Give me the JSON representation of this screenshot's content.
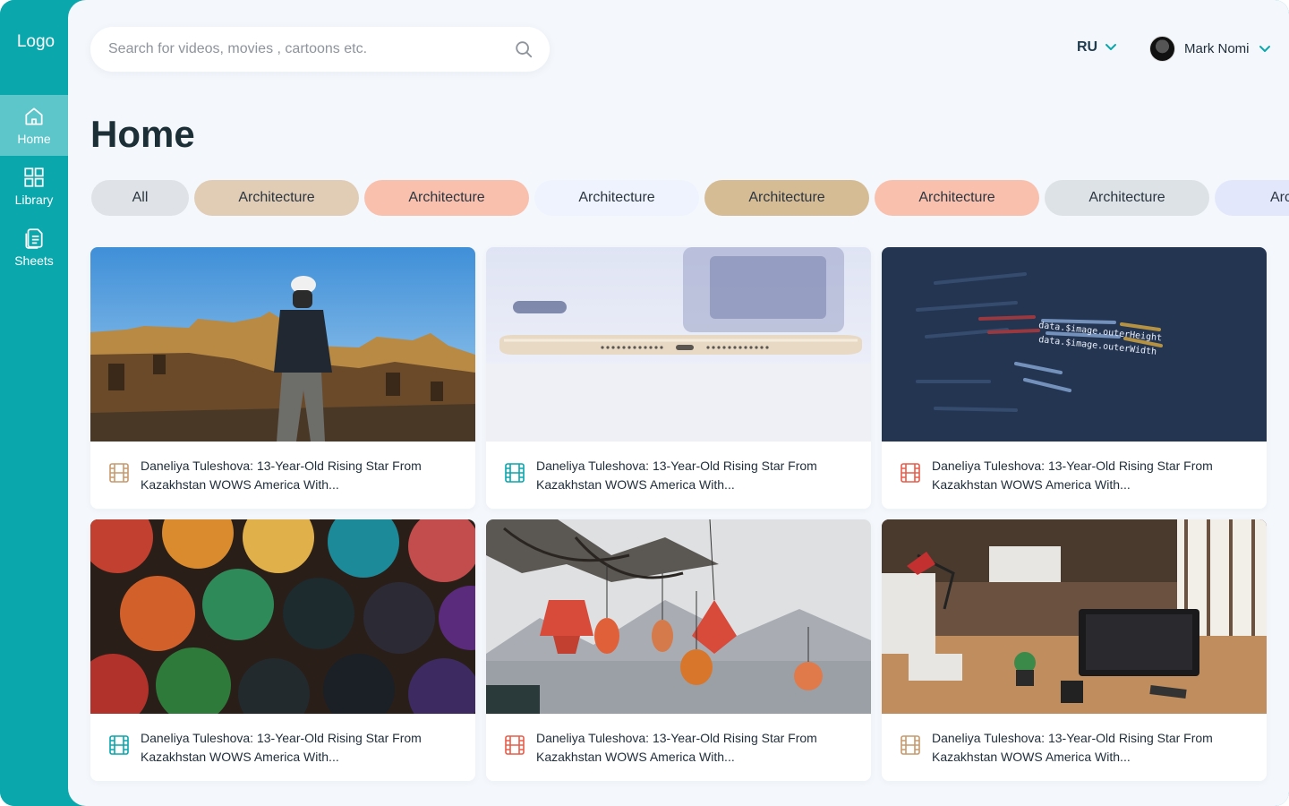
{
  "app": {
    "logo": "Logo"
  },
  "sidebar": {
    "items": [
      {
        "label": "Home",
        "icon": "home-icon",
        "active": true
      },
      {
        "label": "Library",
        "icon": "grid-icon",
        "active": false
      },
      {
        "label": "Sheets",
        "icon": "document-icon",
        "active": false
      }
    ]
  },
  "header": {
    "search_placeholder": "Search for videos, movies , cartoons etc.",
    "language": "RU",
    "user_name": "Mark Nomi"
  },
  "page": {
    "title": "Home"
  },
  "categories": [
    {
      "label": "All",
      "color": "#dfe3e8"
    },
    {
      "label": "Architecture",
      "color": "#e1cdb5"
    },
    {
      "label": "Architecture",
      "color": "#f9c0ae"
    },
    {
      "label": "Architecture",
      "color": "#eff3fd"
    },
    {
      "label": "Architecture",
      "color": "#d6bc94"
    },
    {
      "label": "Architecture",
      "color": "#f9c0ae"
    },
    {
      "label": "Architecture",
      "color": "#dde2e7"
    },
    {
      "label": "Architecture",
      "color": "#e3e7fb"
    }
  ],
  "cards": [
    {
      "title": "Daneliya Tuleshova: 13-Year-Old Rising Star From Kazakhstan WOWS America With...",
      "icon_color": "#c69a6d",
      "image": "man-in-ruins"
    },
    {
      "title": "Daneliya Tuleshova: 13-Year-Old Rising Star From Kazakhstan WOWS America With...",
      "icon_color": "#0aa7ad",
      "image": "tablet-edge"
    },
    {
      "title": "Daneliya Tuleshova: 13-Year-Old Rising Star From Kazakhstan WOWS America With...",
      "icon_color": "#e85d4a",
      "image": "code-screen"
    },
    {
      "title": "Daneliya Tuleshova: 13-Year-Old Rising Star From Kazakhstan WOWS America With...",
      "icon_color": "#0aa7ad",
      "image": "paint-jars"
    },
    {
      "title": "Daneliya Tuleshova: 13-Year-Old Rising Star From Kazakhstan WOWS America With...",
      "icon_color": "#e85d4a",
      "image": "lanterns-lake"
    },
    {
      "title": "Daneliya Tuleshova: 13-Year-Old Rising Star From Kazakhstan WOWS America With...",
      "icon_color": "#c69a6d",
      "image": "office-desks"
    }
  ],
  "colors": {
    "brand": "#0aa7ad",
    "sidebar_active": "#5cc6ca",
    "background": "#f4f8fc"
  }
}
